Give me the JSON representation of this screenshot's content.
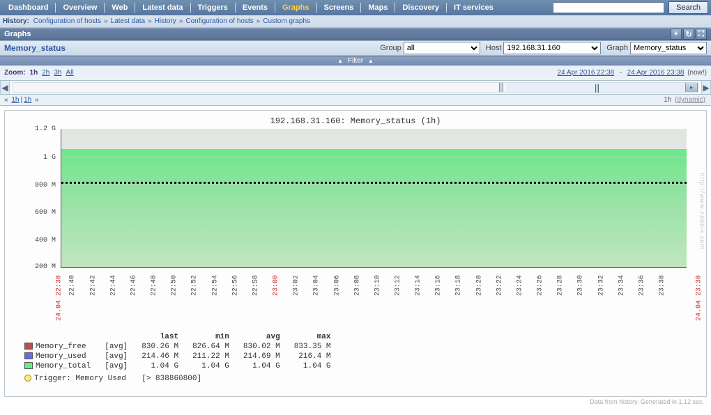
{
  "nav": {
    "items": [
      "Dashboard",
      "Overview",
      "Web",
      "Latest data",
      "Triggers",
      "Events",
      "Graphs",
      "Screens",
      "Maps",
      "Discovery",
      "IT services"
    ],
    "active": "Graphs",
    "search_placeholder": "",
    "search_btn": "Search"
  },
  "history": {
    "label": "History:",
    "crumbs": [
      "Configuration of hosts",
      "Latest data",
      "History",
      "Configuration of hosts",
      "Custom graphs"
    ]
  },
  "section_title": "Graphs",
  "filter": {
    "page_title": "Memory_status",
    "group_label": "Group",
    "group_value": "all",
    "host_label": "Host",
    "host_value": "192.168.31.160",
    "graph_label": "Graph",
    "graph_value": "Memory_status",
    "filter_label": "Filter"
  },
  "zoom": {
    "label": "Zoom:",
    "current": "1h",
    "links": [
      "2h",
      "3h",
      "All"
    ],
    "time_from": "24 Apr 2016 22:38",
    "time_to": "24 Apr 2016 23:38",
    "now_label": "(now!)",
    "back_1h": "1h",
    "fwd_1h": "1h",
    "dynamic_label": "1h",
    "dynamic_word": "(dynamic)"
  },
  "chart_data": {
    "type": "area",
    "title": "192.168.31.160: Memory_status (1h)",
    "ylabel": "",
    "xlabel": "",
    "ylim": [
      200000000,
      1200000000
    ],
    "y_ticks": [
      "1.2 G",
      "1 G",
      "800 M",
      "600 M",
      "400 M",
      "200 M"
    ],
    "x_ticks": [
      "22:40",
      "22:42",
      "22:44",
      "22:46",
      "22:48",
      "22:50",
      "22:52",
      "22:54",
      "22:56",
      "22:58",
      "23:00",
      "23:02",
      "23:04",
      "23:06",
      "23:08",
      "23:10",
      "23:12",
      "23:14",
      "23:16",
      "23:18",
      "23:20",
      "23:22",
      "23:24",
      "23:26",
      "23:28",
      "23:30",
      "23:32",
      "23:34",
      "23:36",
      "23:38"
    ],
    "x_start_label": "24.04 22:38",
    "x_end_label": "24.04 23:38",
    "x_hour_mark": "23:00",
    "series": [
      {
        "name": "Memory_free",
        "color": "#c24b4b",
        "agg": "avg",
        "last": "830.26 M",
        "min": "826.64 M",
        "avg": "830.02 M",
        "max": "833.35 M"
      },
      {
        "name": "Memory_used",
        "color": "#6a6aee",
        "agg": "avg",
        "last": "214.46 M",
        "min": "211.22 M",
        "avg": "214.69 M",
        "max": "216.4 M"
      },
      {
        "name": "Memory_total",
        "color": "#6ce88b",
        "agg": "avg",
        "last": "1.04 G",
        "min": "1.04 G",
        "avg": "1.04 G",
        "max": "1.04 G"
      }
    ],
    "trigger": {
      "label": "Trigger: Memory Used",
      "threshold": "[> 838860800]"
    }
  },
  "legend_headers": [
    "last",
    "min",
    "avg",
    "max"
  ],
  "footer": "Data from history. Generated in 1.12 sec.",
  "watermark": "http://www.zabbix.com"
}
